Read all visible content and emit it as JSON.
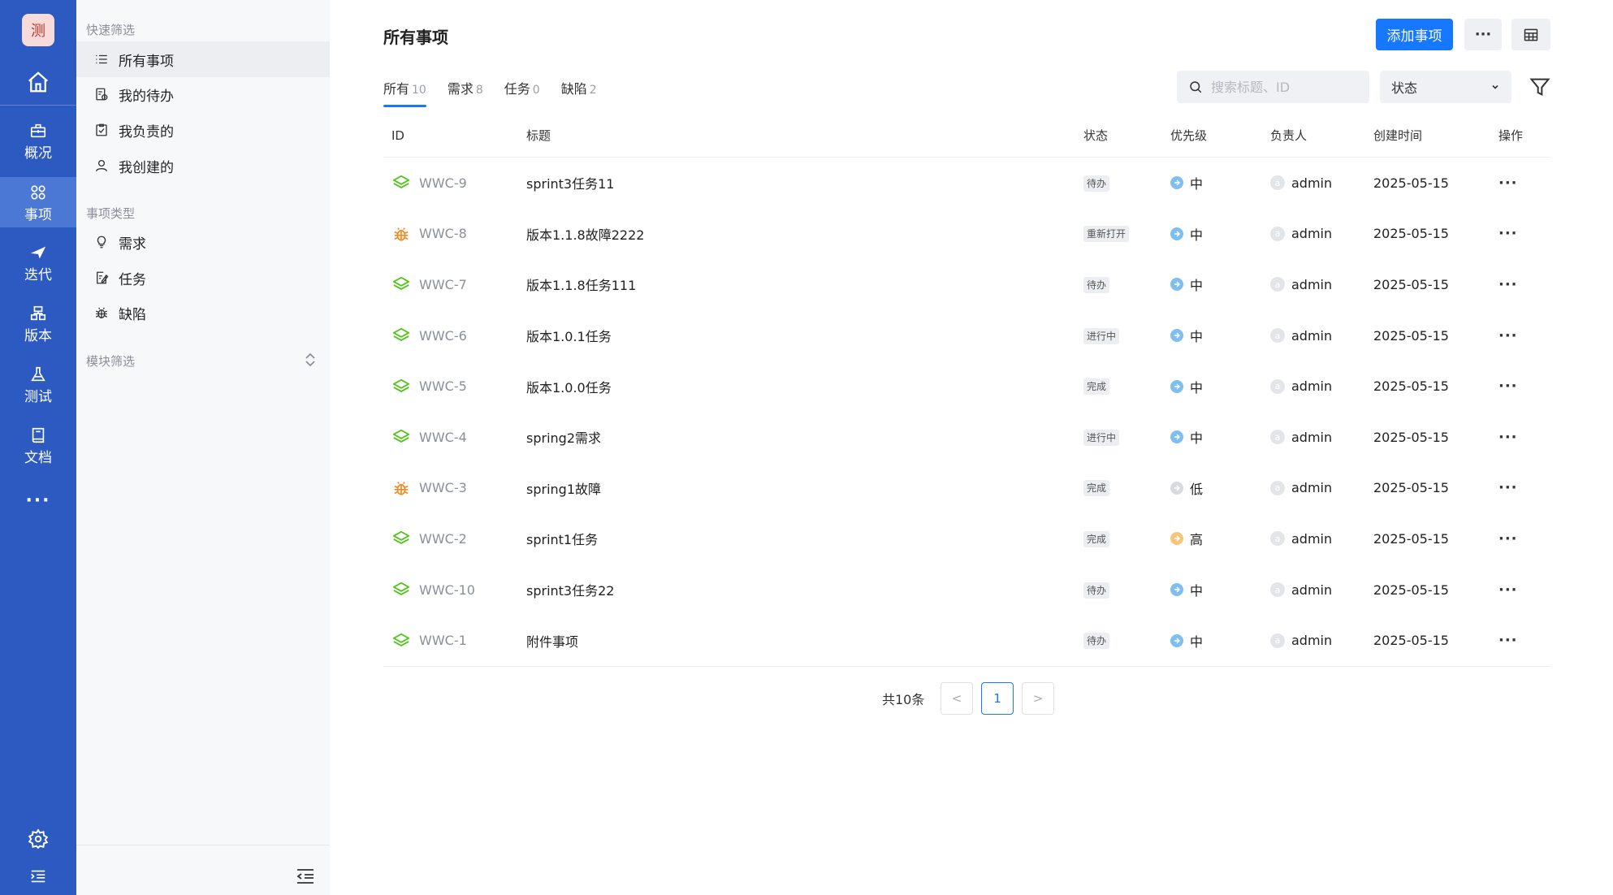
{
  "rail": {
    "logo": "测",
    "items": [
      {
        "label": "概况",
        "icon": "briefcase-icon"
      },
      {
        "label": "事项",
        "icon": "items-icon"
      },
      {
        "label": "迭代",
        "icon": "sprint-icon"
      },
      {
        "label": "版本",
        "icon": "version-icon"
      },
      {
        "label": "测试",
        "icon": "flask-icon"
      },
      {
        "label": "文档",
        "icon": "book-icon"
      }
    ],
    "more": "···"
  },
  "sidebar": {
    "quick_filter_title": "快速筛选",
    "quick_filters": [
      {
        "label": "所有事项"
      },
      {
        "label": "我的待办"
      },
      {
        "label": "我负责的"
      },
      {
        "label": "我创建的"
      }
    ],
    "type_title": "事项类型",
    "types": [
      {
        "label": "需求"
      },
      {
        "label": "任务"
      },
      {
        "label": "缺陷"
      }
    ],
    "module_title": "模块筛选"
  },
  "header": {
    "title": "所有事项",
    "add_button": "添加事项"
  },
  "tabs": [
    {
      "label": "所有",
      "count": "10"
    },
    {
      "label": "需求",
      "count": "8"
    },
    {
      "label": "任务",
      "count": "0"
    },
    {
      "label": "缺陷",
      "count": "2"
    }
  ],
  "search": {
    "placeholder": "搜索标题、ID"
  },
  "status_filter": {
    "value": "状态"
  },
  "table": {
    "columns": {
      "id": "ID",
      "title": "标题",
      "status": "状态",
      "priority": "优先级",
      "owner": "负责人",
      "created": "创建时间",
      "ops": "操作"
    },
    "rows": [
      {
        "type": "task",
        "id": "WWC-9",
        "title": "sprint3任务11",
        "status": "待办",
        "priority": "中",
        "owner": "admin",
        "created": "2025-05-15"
      },
      {
        "type": "bug",
        "id": "WWC-8",
        "title": "版本1.1.8故障2222",
        "status": "重新打开",
        "priority": "中",
        "owner": "admin",
        "created": "2025-05-15"
      },
      {
        "type": "task",
        "id": "WWC-7",
        "title": "版本1.1.8任务111",
        "status": "待办",
        "priority": "中",
        "owner": "admin",
        "created": "2025-05-15"
      },
      {
        "type": "task",
        "id": "WWC-6",
        "title": "版本1.0.1任务",
        "status": "进行中",
        "priority": "中",
        "owner": "admin",
        "created": "2025-05-15"
      },
      {
        "type": "task",
        "id": "WWC-5",
        "title": "版本1.0.0任务",
        "status": "完成",
        "priority": "中",
        "owner": "admin",
        "created": "2025-05-15"
      },
      {
        "type": "task",
        "id": "WWC-4",
        "title": "spring2需求",
        "status": "进行中",
        "priority": "中",
        "owner": "admin",
        "created": "2025-05-15"
      },
      {
        "type": "bug",
        "id": "WWC-3",
        "title": "spring1故障",
        "status": "完成",
        "priority": "低",
        "owner": "admin",
        "created": "2025-05-15"
      },
      {
        "type": "task",
        "id": "WWC-2",
        "title": "sprint1任务",
        "status": "完成",
        "priority": "高",
        "owner": "admin",
        "created": "2025-05-15"
      },
      {
        "type": "task",
        "id": "WWC-10",
        "title": "sprint3任务22",
        "status": "待办",
        "priority": "中",
        "owner": "admin",
        "created": "2025-05-15"
      },
      {
        "type": "task",
        "id": "WWC-1",
        "title": "附件事项",
        "status": "待办",
        "priority": "中",
        "owner": "admin",
        "created": "2025-05-15"
      }
    ],
    "op_label": "···",
    "avatar_letter": "a"
  },
  "pagination": {
    "total": "共10条",
    "current": "1",
    "prev": "<",
    "next": ">"
  },
  "colors": {
    "rail": "#2c5ac0",
    "primary": "#1677ff",
    "task_icon": "#52c41a",
    "bug_icon": "#f5891f",
    "prio_mid": "#7fbff0",
    "prio_low": "#d8dadd",
    "prio_high": "#f5c67a"
  }
}
